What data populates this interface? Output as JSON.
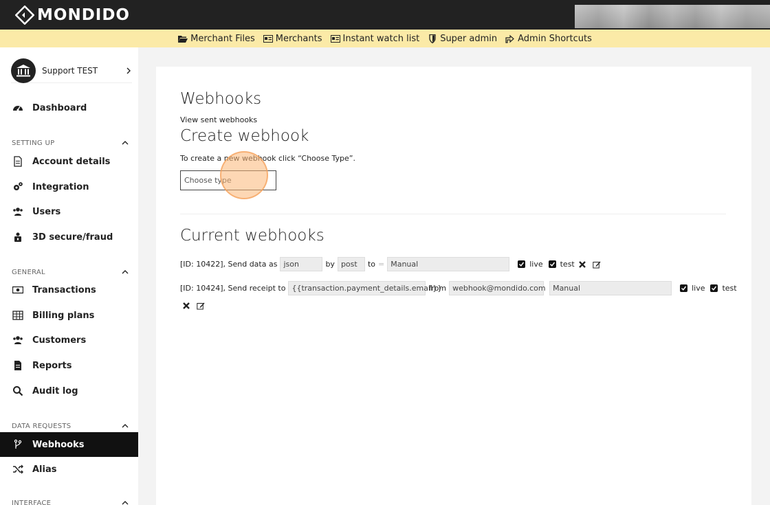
{
  "brand": {
    "name": "MONDIDO"
  },
  "admin_bar": {
    "items": [
      {
        "label": "Merchant Files",
        "icon": "folder-open-icon"
      },
      {
        "label": "Merchants",
        "icon": "id-card-icon"
      },
      {
        "label": "Instant watch list",
        "icon": "list-card-icon"
      },
      {
        "label": "Super admin",
        "icon": "shield-icon"
      },
      {
        "label": "Admin Shortcuts",
        "icon": "share-icon"
      }
    ]
  },
  "sidebar": {
    "account": {
      "name": "Support TEST",
      "icon": "bank-icon"
    },
    "dashboard": "Dashboard",
    "sections": {
      "setting_up": "SETTING UP",
      "general": "GENERAL",
      "data_requests": "DATA REQUESTS",
      "interface": "INTERFACE"
    },
    "items": {
      "account_details": "Account details",
      "integration": "Integration",
      "users": "Users",
      "secure": "3D secure/fraud",
      "transactions": "Transactions",
      "billing_plans": "Billing plans",
      "customers": "Customers",
      "reports": "Reports",
      "audit_log": "Audit log",
      "webhooks": "Webhooks",
      "alias": "Alias"
    }
  },
  "main": {
    "title": "Webhooks",
    "view_sent": "View sent webhooks",
    "create_title": "Create webhook",
    "create_help": "To create a new webhook click “Choose Type”.",
    "choose_type_placeholder": "Choose type",
    "current_title": "Current webhooks",
    "webhooks": [
      {
        "id_label": "[ID: 10422],",
        "action": "Send data as",
        "format": "json",
        "by_label": "by",
        "method": "post",
        "to_label": "to",
        "target": "Manual",
        "live_label": "live",
        "test_label": "test"
      },
      {
        "id_label": "[ID: 10424],",
        "action": "Send receipt to",
        "recipient": "{{transaction.payment_details.email}}",
        "from_label": "from",
        "sender": "webhook@mondido.com",
        "target": "Manual",
        "live_label": "live",
        "test_label": "test"
      }
    ]
  },
  "colors": {
    "topbar": "#222222",
    "admin_bar": "#fbeaa7",
    "active_nav": "#111111",
    "cursor": "#fcb776"
  }
}
